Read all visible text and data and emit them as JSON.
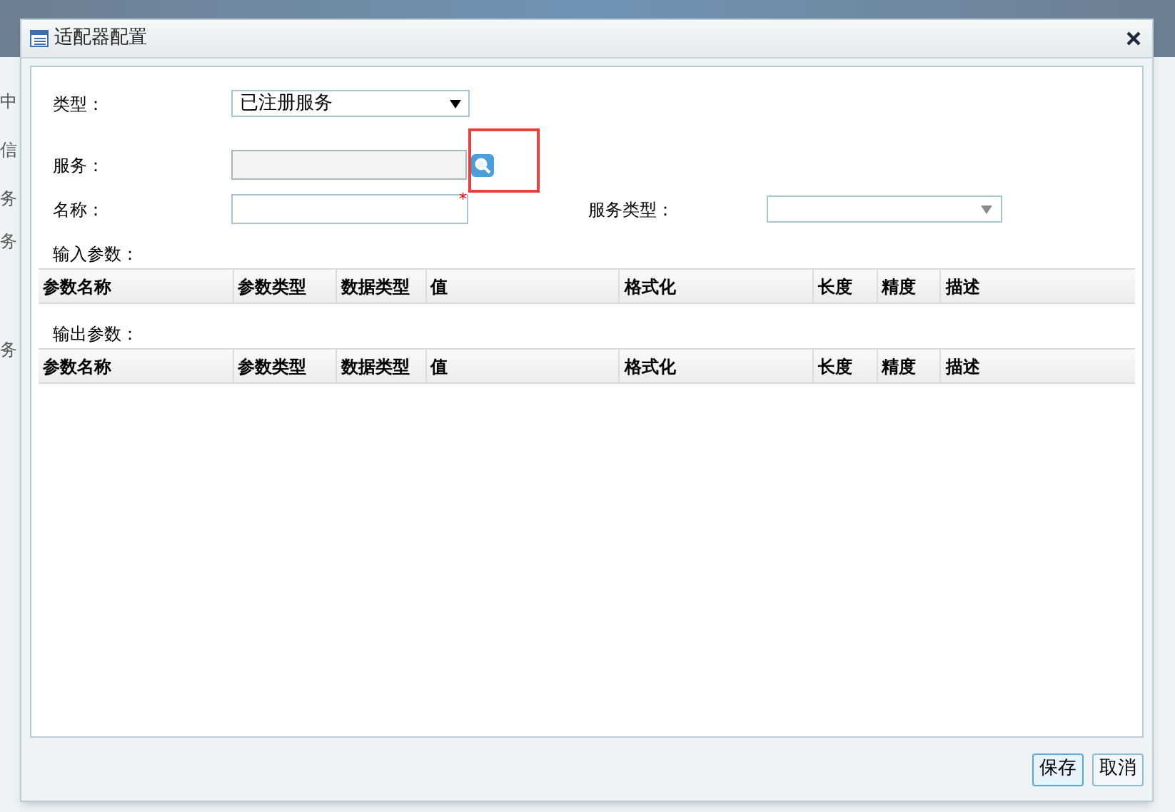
{
  "background": {
    "fragments": [
      "中",
      "信",
      "务",
      "务",
      "务"
    ]
  },
  "dialog": {
    "title": "适配器配置",
    "form": [
      {
        "kind": "select",
        "label": "类型：",
        "value": "已注册服务"
      },
      {
        "kind": "lookup",
        "label": "服务：",
        "disabled": true,
        "highlighted": true
      },
      {
        "kind": "text",
        "label": "名称：",
        "required": "*",
        "side_label": "服务类型："
      }
    ],
    "tables": [
      {
        "caption": "输入参数：",
        "columns": [
          "参数名称",
          "参数类型",
          "数据类型",
          "值",
          "格式化",
          "长度",
          "精度",
          "描述"
        ]
      },
      {
        "caption": "输出参数：",
        "columns": [
          "参数名称",
          "参数类型",
          "数据类型",
          "值",
          "格式化",
          "长度",
          "精度",
          "描述"
        ]
      }
    ],
    "buttons": [
      "保存",
      "取消"
    ]
  }
}
